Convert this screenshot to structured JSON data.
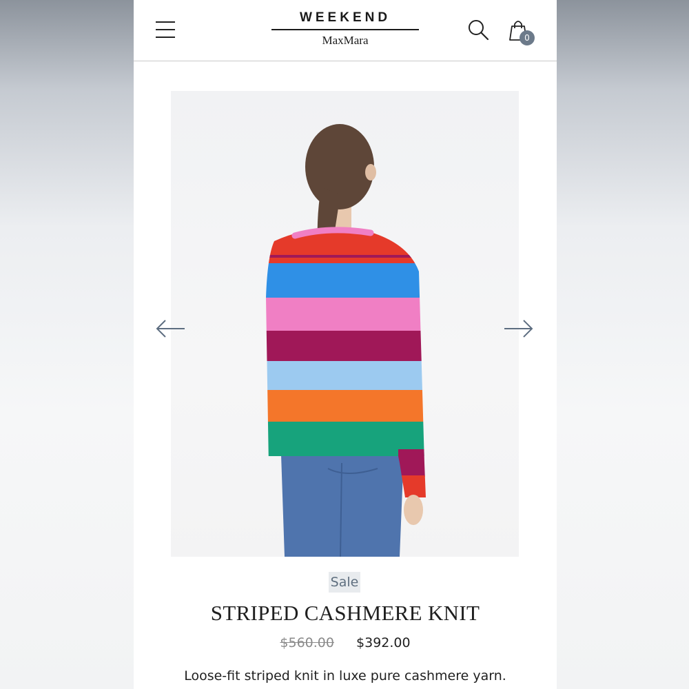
{
  "header": {
    "menu_icon": "hamburger-menu-icon",
    "brand_top": "WEEKEND",
    "brand_bottom": "MaxMara",
    "search_icon": "search-icon",
    "bag_icon": "shopping-bag-icon",
    "bag_count": "0"
  },
  "gallery": {
    "prev_icon": "arrow-left-icon",
    "next_icon": "arrow-right-icon",
    "stripe_colors": [
      "#e53a2a",
      "#2f90e6",
      "#f07fc4",
      "#a01858",
      "#9ccaf0",
      "#f4762a",
      "#17a37c"
    ]
  },
  "product": {
    "badge": "Sale",
    "title": "STRIPED CASHMERE KNIT",
    "price_original": "$560.00",
    "price_sale": "$392.00",
    "description": "Loose-fit striped knit in luxe pure cashmere yarn."
  },
  "colors": {
    "badge_bg": "#e8ebee",
    "badge_text": "#5f6f7f",
    "bag_count_bg": "#6c7a8a"
  }
}
